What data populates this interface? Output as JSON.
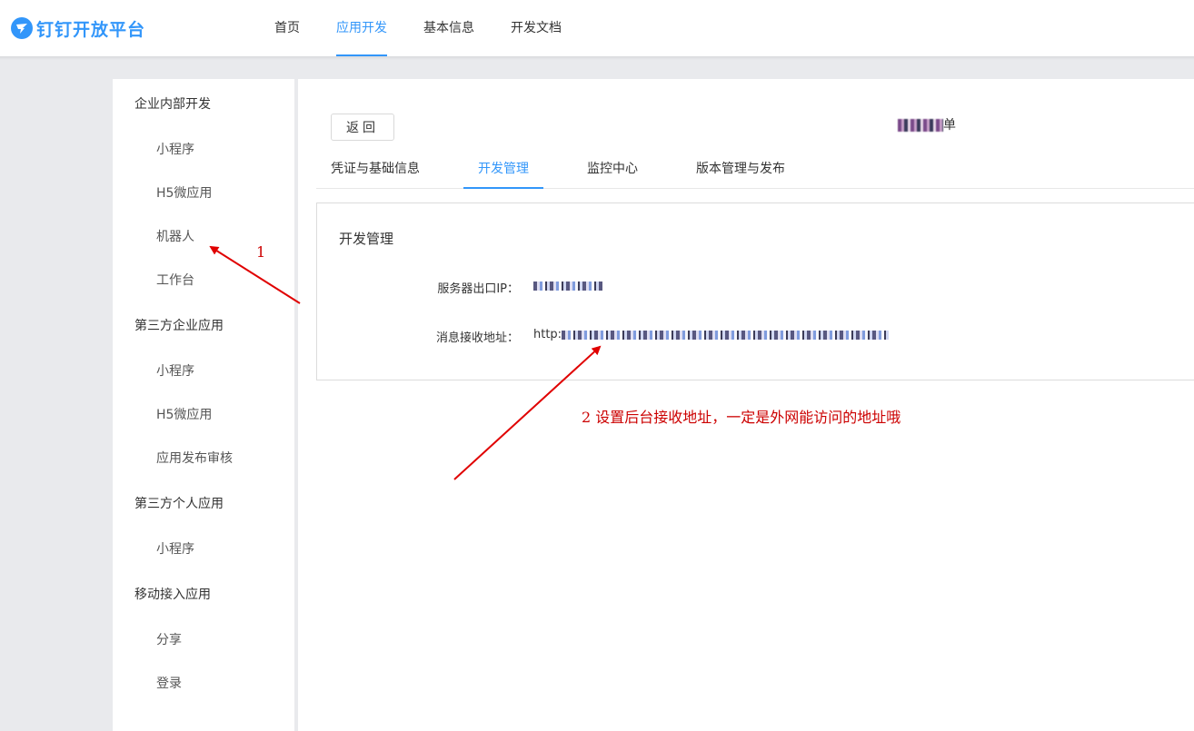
{
  "brand": {
    "name": "钉钉开放平台",
    "color": "#3296fa",
    "icon": "dingtalk-logo-icon"
  },
  "nav": {
    "items": [
      {
        "label": "首页",
        "active": false
      },
      {
        "label": "应用开发",
        "active": true
      },
      {
        "label": "基本信息",
        "active": false
      },
      {
        "label": "开发文档",
        "active": false
      }
    ]
  },
  "sidebar": {
    "groups": [
      {
        "title": "企业内部开发",
        "items": [
          "小程序",
          "H5微应用",
          "机器人",
          "工作台"
        ]
      },
      {
        "title": "第三方企业应用",
        "items": [
          "小程序",
          "H5微应用",
          "应用发布审核"
        ]
      },
      {
        "title": "第三方个人应用",
        "items": [
          "小程序"
        ]
      },
      {
        "title": "移动接入应用",
        "items": [
          "分享",
          "登录"
        ]
      }
    ]
  },
  "main": {
    "back_label": "返回",
    "app_name_suffix": "单",
    "tabs": [
      {
        "label": "凭证与基础信息",
        "active": false
      },
      {
        "label": "开发管理",
        "active": true
      },
      {
        "label": "监控中心",
        "active": false
      },
      {
        "label": "版本管理与发布",
        "active": false
      }
    ],
    "panel": {
      "title": "开发管理",
      "server_ip_label": "服务器出口IP：",
      "message_url_label": "消息接收地址：",
      "message_url_prefix": "http:"
    }
  },
  "annotations": {
    "note1": "1",
    "note2": "2  设置后台接收地址，一定是外网能访问的地址哦",
    "color": "#cc0000"
  }
}
